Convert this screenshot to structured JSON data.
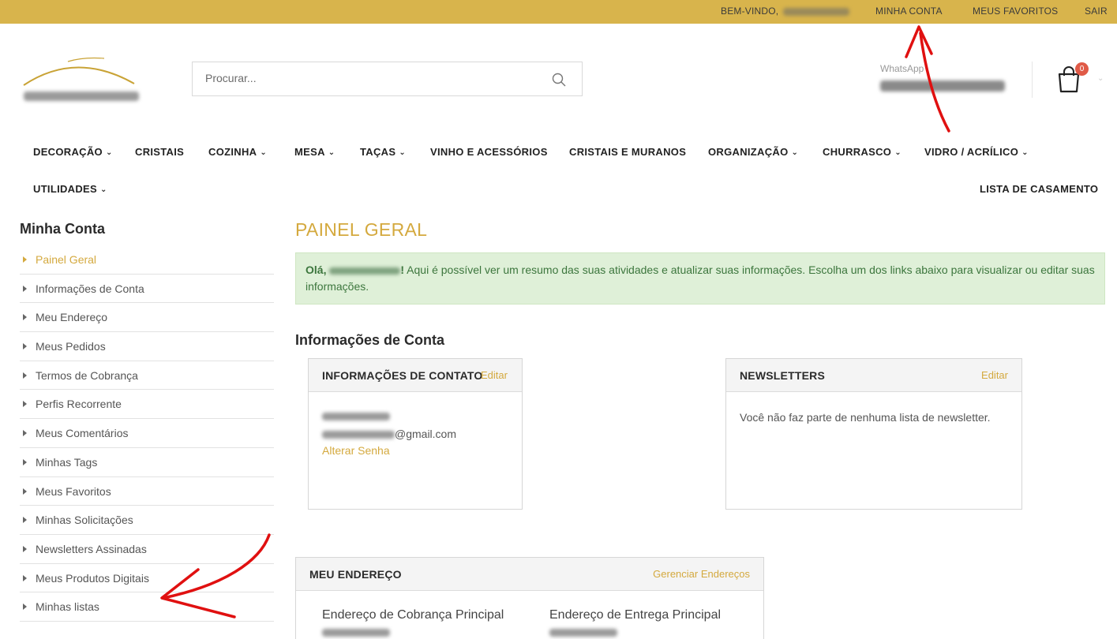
{
  "topbar": {
    "welcome": "BEM-VINDO,",
    "my_account": "MINHA CONTA",
    "favorites": "MEUS FAVORITOS",
    "logout": "SAIR"
  },
  "header": {
    "search_placeholder": "Procurar...",
    "whatsapp_label": "WhatsApp",
    "cart_count": "0"
  },
  "nav": {
    "items": [
      {
        "label": "DECORAÇÃO",
        "dropdown": true
      },
      {
        "label": "CRISTAIS",
        "dropdown": false
      },
      {
        "label": "COZINHA",
        "dropdown": true
      },
      {
        "label": "MESA",
        "dropdown": true
      },
      {
        "label": "TAÇAS",
        "dropdown": true
      },
      {
        "label": "VINHO E ACESSÓRIOS",
        "dropdown": false
      },
      {
        "label": "CRISTAIS E MURANOS",
        "dropdown": false
      },
      {
        "label": "ORGANIZAÇÃO",
        "dropdown": true
      },
      {
        "label": "CHURRASCO",
        "dropdown": true
      },
      {
        "label": "VIDRO / ACRÍLICO",
        "dropdown": true
      },
      {
        "label": "UTILIDADES",
        "dropdown": true
      },
      {
        "label": "LISTA DE CASAMENTO",
        "dropdown": false
      }
    ]
  },
  "sidebar": {
    "title": "Minha Conta",
    "items": [
      {
        "label": "Painel Geral",
        "active": true
      },
      {
        "label": "Informações de Conta"
      },
      {
        "label": "Meu Endereço"
      },
      {
        "label": "Meus Pedidos"
      },
      {
        "label": "Termos de Cobrança"
      },
      {
        "label": "Perfis Recorrente"
      },
      {
        "label": "Meus Comentários"
      },
      {
        "label": "Minhas Tags"
      },
      {
        "label": "Meus Favoritos"
      },
      {
        "label": "Minhas Solicitações"
      },
      {
        "label": "Newsletters Assinadas"
      },
      {
        "label": "Meus Produtos Digitais"
      },
      {
        "label": "Minhas listas"
      }
    ]
  },
  "main": {
    "page_title": "PAINEL GERAL",
    "alert_greeting": "Olá,",
    "alert_text": "Aqui é possível ver um resumo das suas atividades e atualizar suas informações. Escolha um dos links abaixo para visualizar ou editar suas informações.",
    "account_info_title": "Informações de Conta",
    "contact_box": {
      "title": "INFORMAÇÕES DE CONTATO",
      "edit": "Editar",
      "email_suffix": "@gmail.com",
      "change_password": "Alterar Senha"
    },
    "newsletter_box": {
      "title": "NEWSLETTERS",
      "edit": "Editar",
      "text": "Você não faz parte de nenhuma lista de newsletter."
    },
    "address_box": {
      "title": "MEU ENDEREÇO",
      "manage": "Gerenciar Endereços",
      "billing_title": "Endereço de Cobrança Principal",
      "shipping_title": "Endereço de Entrega Principal"
    }
  },
  "colors": {
    "topbar_bg": "#d8b44c",
    "accent_gold": "#d4a93e",
    "alert_bg": "#dff0d8",
    "alert_text": "#3c763d",
    "badge_red": "#e05a47",
    "annotation_red": "#e01010"
  }
}
